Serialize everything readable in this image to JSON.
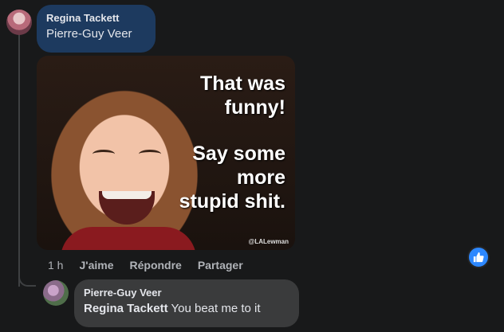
{
  "comment": {
    "author": "Regina Tackett",
    "text": "Pierre-Guy Veer",
    "image": {
      "lines_top": [
        "That was",
        "funny!"
      ],
      "lines_bottom": [
        "Say some",
        "more",
        "stupid shit."
      ],
      "watermark": "@LALewman"
    },
    "time": "1 h",
    "actions": {
      "like": "J'aime",
      "reply": "Répondre",
      "share": "Partager"
    }
  },
  "reply": {
    "author": "Pierre-Guy Veer",
    "mention": "Regina Tackett",
    "text": " You beat me to it"
  },
  "colors": {
    "background": "#18191a",
    "bubble_highlight": "#1d3a5f",
    "bubble": "#3a3b3c",
    "like_blue": "#2d88ff"
  }
}
